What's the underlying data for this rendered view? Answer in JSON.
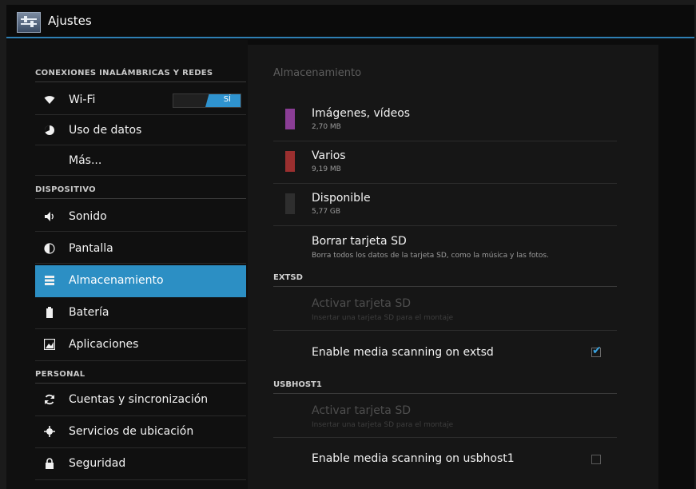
{
  "app": {
    "title": "Ajustes",
    "icon": "settings-sliders-icon"
  },
  "sidebar": {
    "categories": {
      "wireless": "CONEXIONES INALÁMBRICAS Y REDES",
      "device": "DISPOSITIVO",
      "personal": "PERSONAL"
    },
    "items": [
      {
        "label": "Wi-Fi",
        "icon": "wifi-icon",
        "toggle": "SÍ"
      },
      {
        "label": "Uso de datos",
        "icon": "data-usage-icon"
      },
      {
        "label": "Más..."
      },
      {
        "label": "Sonido",
        "icon": "speaker-icon"
      },
      {
        "label": "Pantalla",
        "icon": "display-icon"
      },
      {
        "label": "Almacenamiento",
        "icon": "storage-icon",
        "selected": true
      },
      {
        "label": "Batería",
        "icon": "battery-icon"
      },
      {
        "label": "Aplicaciones",
        "icon": "apps-icon"
      },
      {
        "label": "Cuentas y sincronización",
        "icon": "sync-icon"
      },
      {
        "label": "Servicios de ubicación",
        "icon": "location-icon"
      },
      {
        "label": "Seguridad",
        "icon": "lock-icon"
      }
    ]
  },
  "storage": {
    "title": "Almacenamiento",
    "entries": [
      {
        "label": "Imágenes, vídeos",
        "size": "2,70 MB",
        "color": "#8a3d95"
      },
      {
        "label": "Varios",
        "size": "9,19 MB",
        "color": "#9b2f2f"
      },
      {
        "label": "Disponible",
        "size": "5,77 GB",
        "color": "#2e2e2e"
      }
    ],
    "erase": {
      "label": "Borrar tarjeta SD",
      "description": "Borra todos los datos de la tarjeta SD, como la música y las fotos."
    },
    "sections": {
      "extsd": {
        "header": "EXTSD",
        "mount_label": "Activar tarjeta SD",
        "mount_desc": "Insertar una tarjeta SD para el montaje",
        "scan_label": "Enable media scanning on extsd",
        "scan_checked": true
      },
      "usbhost": {
        "header": "USBHOST1",
        "mount_label": "Activar tarjeta SD",
        "mount_desc": "Insertar una tarjeta SD para el montaje",
        "scan_label": "Enable media scanning on usbhost1",
        "scan_checked": false
      }
    }
  }
}
